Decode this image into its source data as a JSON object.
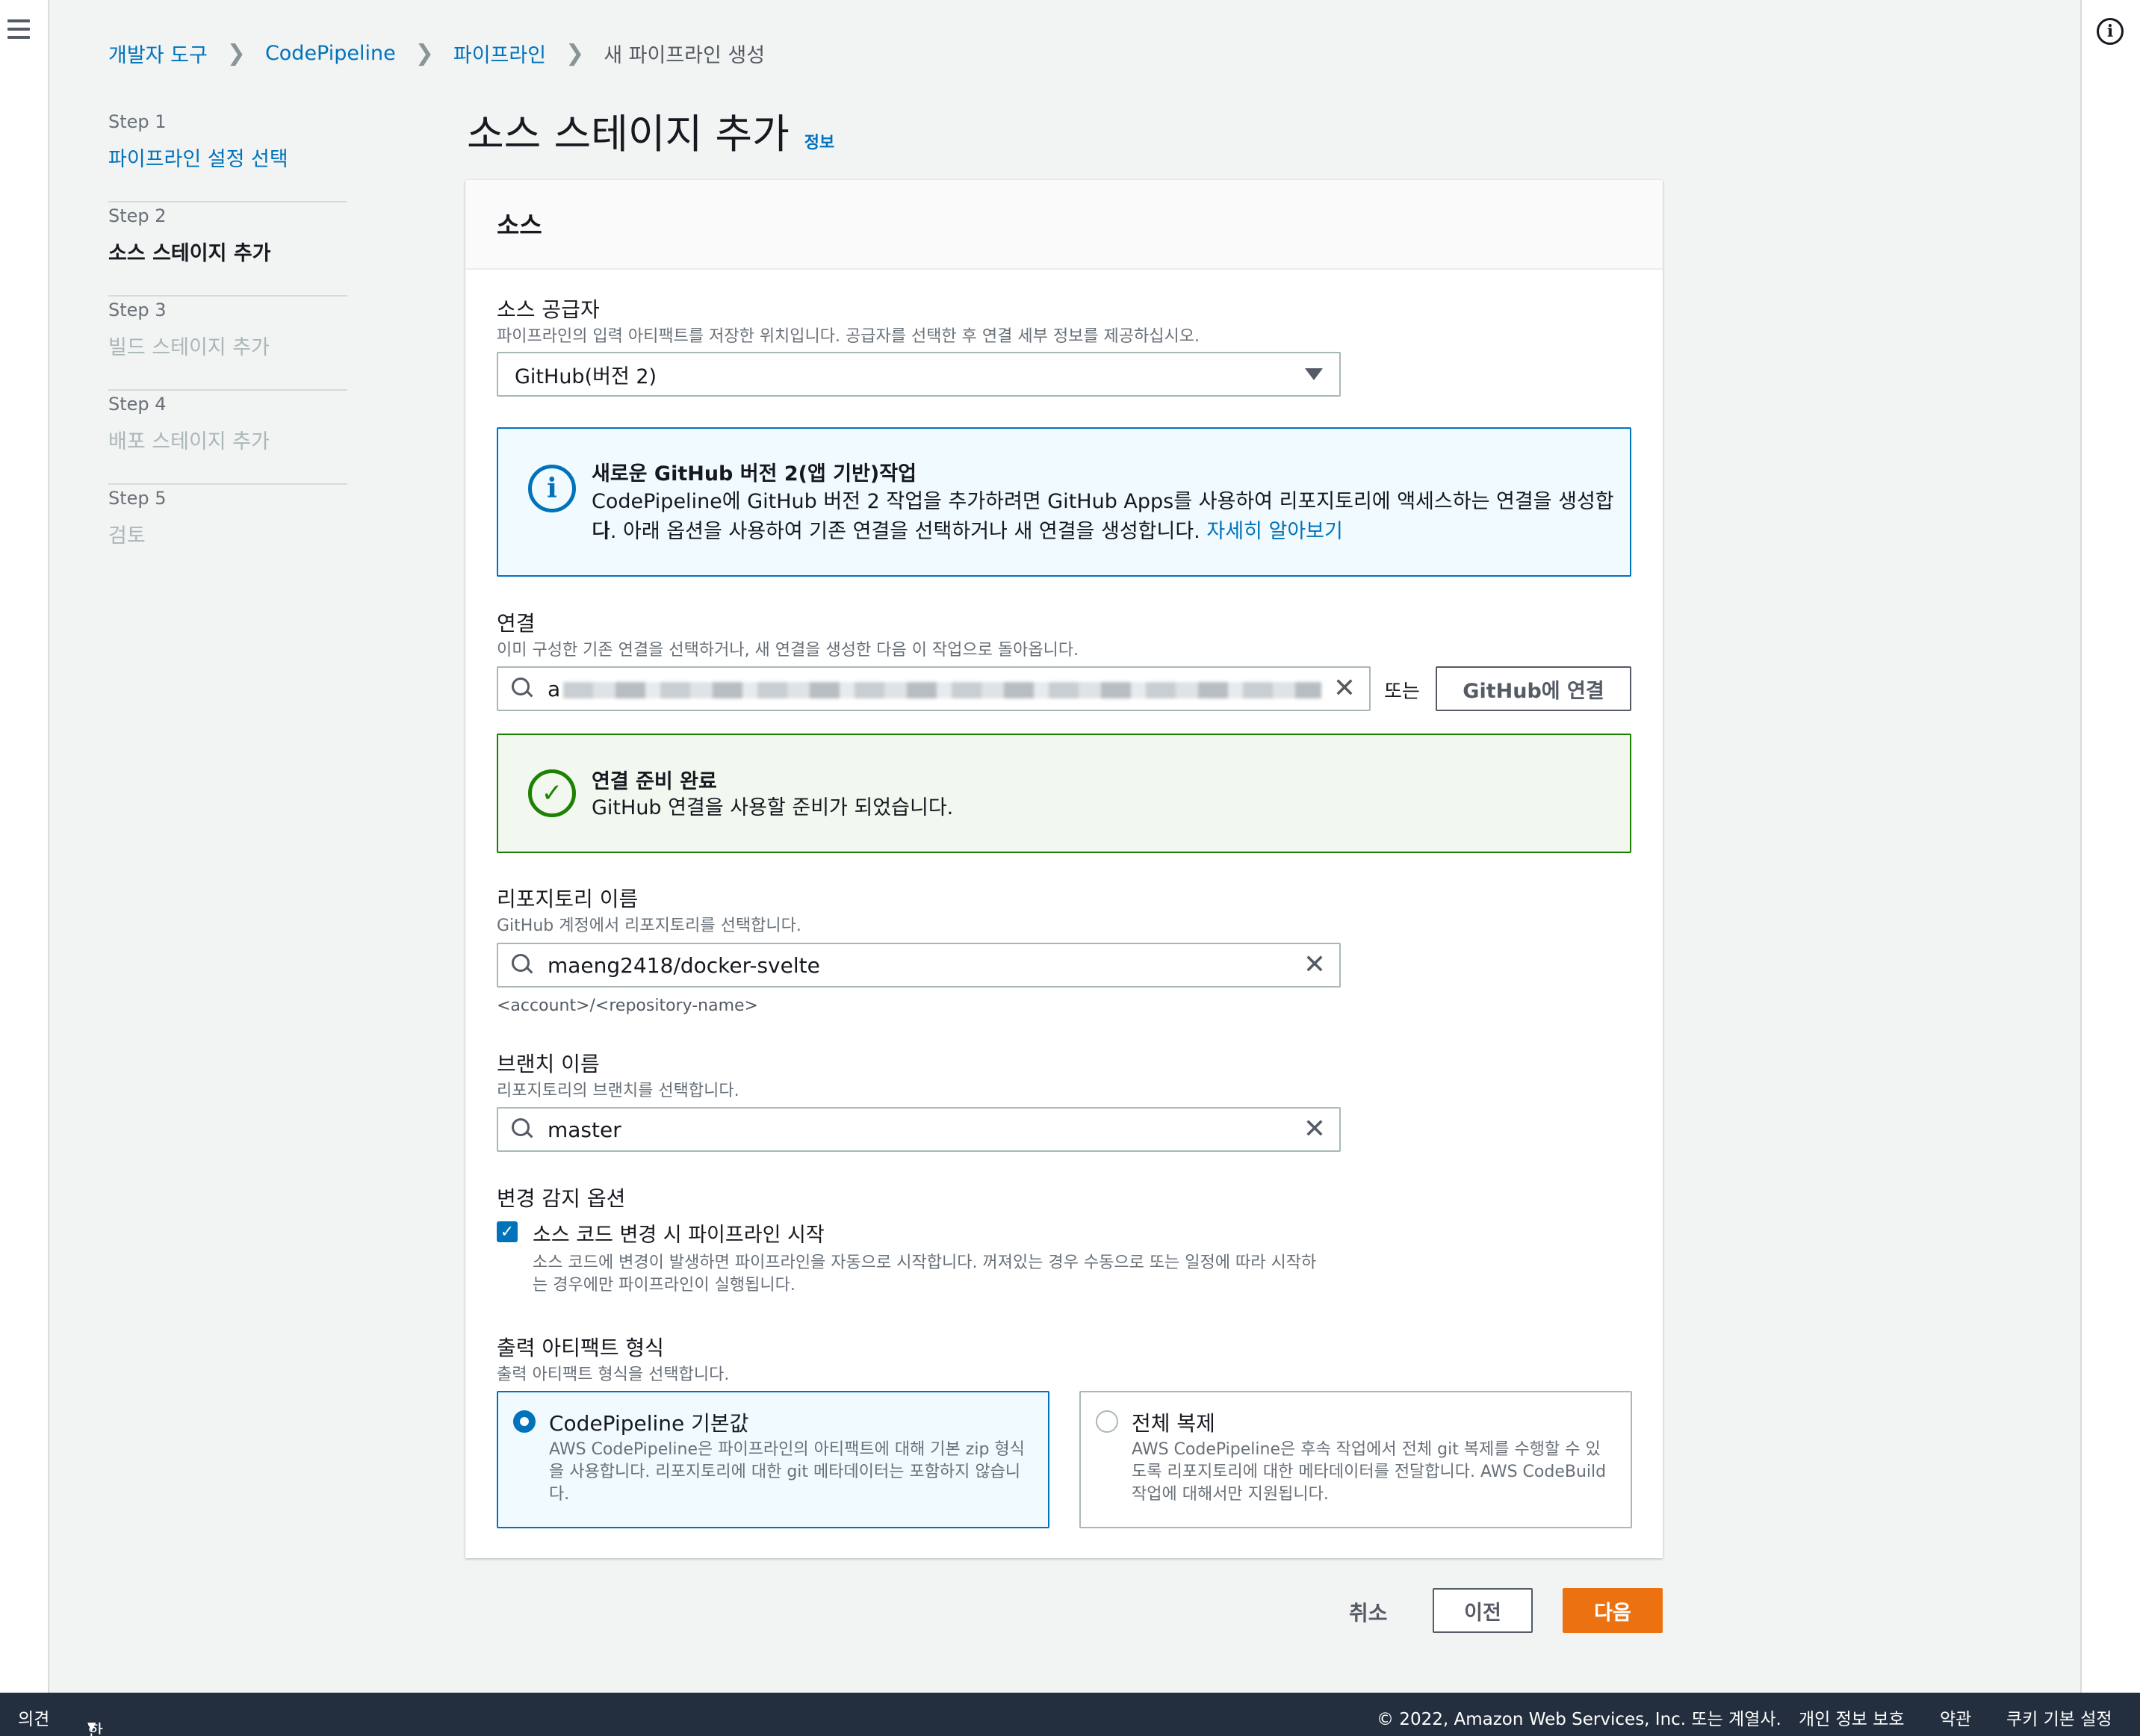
{
  "breadcrumb": {
    "items": [
      "개발자 도구",
      "CodePipeline",
      "파이프라인"
    ],
    "current": "새 파이프라인 생성"
  },
  "steps": [
    {
      "num": "Step 1",
      "title": "파이프라인 설정 선택",
      "state": "done"
    },
    {
      "num": "Step 2",
      "title": "소스 스테이지 추가",
      "state": "active"
    },
    {
      "num": "Step 3",
      "title": "빌드 스테이지 추가",
      "state": "pending"
    },
    {
      "num": "Step 4",
      "title": "배포 스테이지 추가",
      "state": "pending"
    },
    {
      "num": "Step 5",
      "title": "검토",
      "state": "pending"
    }
  ],
  "page": {
    "title": "소스 스테이지 추가",
    "info_link": "정보"
  },
  "panel": {
    "header": "소스",
    "source_provider": {
      "label": "소스 공급자",
      "description": "파이프라인의 입력 아티팩트를 저장한 위치입니다. 공급자를 선택한 후 연결 세부 정보를 제공하십시오.",
      "value": "GitHub(버전 2)"
    },
    "info_alert": {
      "title": "새로운 GitHub 버전 2(앱 기반)작업",
      "body_line1": "CodePipeline에 GitHub 버전 2 작업을 추가하려면 GitHub Apps를 사용하여 리포지토리에 액세스하는 연결을 생성합니",
      "body_line2": "다. 아래 옵션을 사용하여 기존 연결을 선택하거나 새 연결을 생성합니다.",
      "link": "자세히 알아보기"
    },
    "connection": {
      "label": "연결",
      "description": "이미 구성한 기존 연결을 선택하거나, 새 연결을 생성한 다음 이 작업으로 돌아옵니다.",
      "value_prefix": "a",
      "or_text": "또는",
      "connect_button": "GitHub에 연결"
    },
    "success_alert": {
      "title": "연결 준비 완료",
      "body": "GitHub 연결을 사용할 준비가 되었습니다."
    },
    "repository": {
      "label": "리포지토리 이름",
      "description": "GitHub 계정에서 리포지토리를 선택합니다.",
      "value": "maeng2418/docker-svelte",
      "hint": "<account>/<repository-name>"
    },
    "branch": {
      "label": "브랜치 이름",
      "description": "리포지토리의 브랜치를 선택합니다.",
      "value": "master"
    },
    "change_detection": {
      "label": "변경 감지 옵션",
      "checkbox_label": "소스 코드 변경 시 파이프라인 시작",
      "checkbox_desc_line1": "소스 코드에 변경이 발생하면 파이프라인을 자동으로 시작합니다. 꺼져있는 경우 수동으로 또는 일정에 따라 시작하",
      "checkbox_desc_line2": "는 경우에만 파이프라인이 실행됩니다.",
      "checked": true
    },
    "output_artifact": {
      "label": "출력 아티팩트 형식",
      "description": "출력 아티팩트 형식을 선택합니다.",
      "options": [
        {
          "title": "CodePipeline 기본값",
          "desc_line1": "AWS CodePipeline은 파이프라인의 아티팩트에 대해 기본 zip 형식",
          "desc_line2": "을 사용합니다. 리포지토리에 대한 git 메타데이터는 포함하지 않습니",
          "desc_line3": "다.",
          "selected": true
        },
        {
          "title": "전체 복제",
          "desc_line1": "AWS CodePipeline은 후속 작업에서 전체 git 복제를 수행할 수 있",
          "desc_line2": "도록 리포지토리에 대한 메타데이터를 전달합니다. AWS CodeBuild",
          "desc_line3": "작업에 대해서만 지원됩니다.",
          "selected": false
        }
      ]
    }
  },
  "actions": {
    "cancel": "취소",
    "previous": "이전",
    "next": "다음"
  },
  "footer": {
    "feedback": "의견",
    "language": "한국어",
    "copyright": "© 2022, Amazon Web Services, Inc. 또는 계열사.",
    "privacy": "개인 정보 보호",
    "terms": "약관",
    "cookies": "쿠키 기본 설정"
  },
  "colors": {
    "link": "#0073bb",
    "primary_button": "#ec7211",
    "success": "#1d8102",
    "footer_bg": "#232f3e"
  }
}
